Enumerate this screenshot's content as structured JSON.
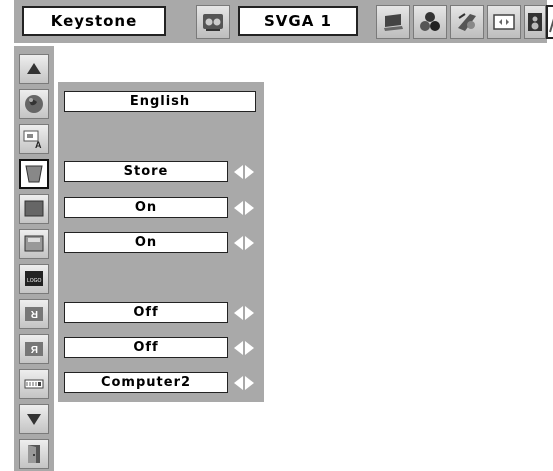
{
  "topbar": {
    "menu_title": "Keystone",
    "input_source": "SVGA 1",
    "icons": [
      "video-test-icon",
      "laptop-icon",
      "color-balls-icon",
      "palette-icon",
      "screen-icon",
      "speaker-icon",
      "wrench-icon"
    ]
  },
  "sidebar": {
    "icons": [
      "scroll-up-icon",
      "globe-icon",
      "menu-position-icon",
      "keystone-icon",
      "blue-background-icon",
      "display-icon",
      "logo-icon",
      "ceiling-mirror-icon",
      "rear-mirror-icon",
      "terminal-icon",
      "scroll-down-icon",
      "exit-door-icon"
    ]
  },
  "panel": {
    "language": "English",
    "keystone": "Store",
    "blue_back": "On",
    "display": "On",
    "ceiling": "Off",
    "rear": "Off",
    "terminal": "Computer2"
  }
}
